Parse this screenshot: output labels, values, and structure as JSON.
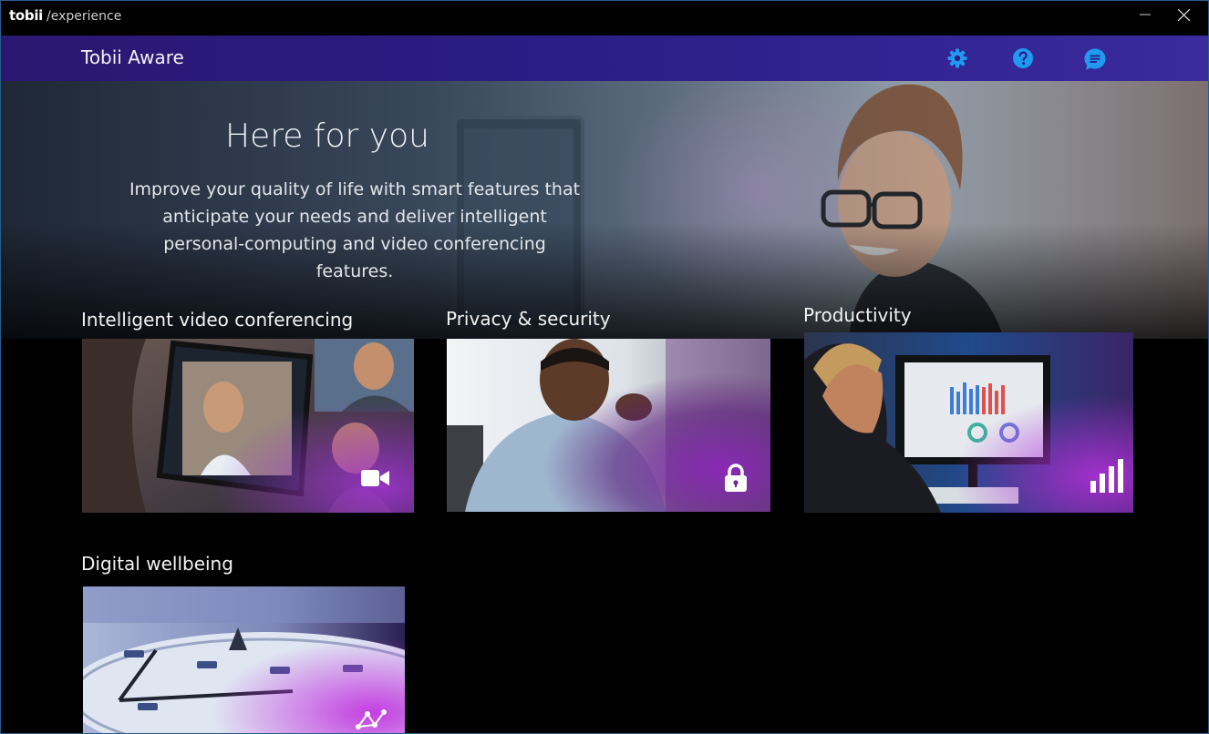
{
  "window": {
    "brand": "tobii",
    "brand_sub": "/experience",
    "controls": {
      "minimize_icon": "minimize-icon",
      "close_icon": "close-icon"
    }
  },
  "header": {
    "title": "Tobii Aware",
    "icons": [
      "gear-icon",
      "help-icon",
      "chat-icon"
    ],
    "accent_color": "#1e9bf0",
    "bar_color": "#2b1c86"
  },
  "hero": {
    "title": "Here for you",
    "description": "Improve your quality of life with smart features that anticipate your needs and deliver intelligent personal-computing and video conferencing features."
  },
  "sections": [
    {
      "title": "Intelligent video conferencing",
      "icon": "video-camera-icon"
    },
    {
      "title": "Privacy & security",
      "icon": "lock-icon"
    },
    {
      "title": "Productivity",
      "icon": "bar-chart-icon"
    },
    {
      "title": "Digital wellbeing",
      "icon": "network-icon"
    }
  ]
}
